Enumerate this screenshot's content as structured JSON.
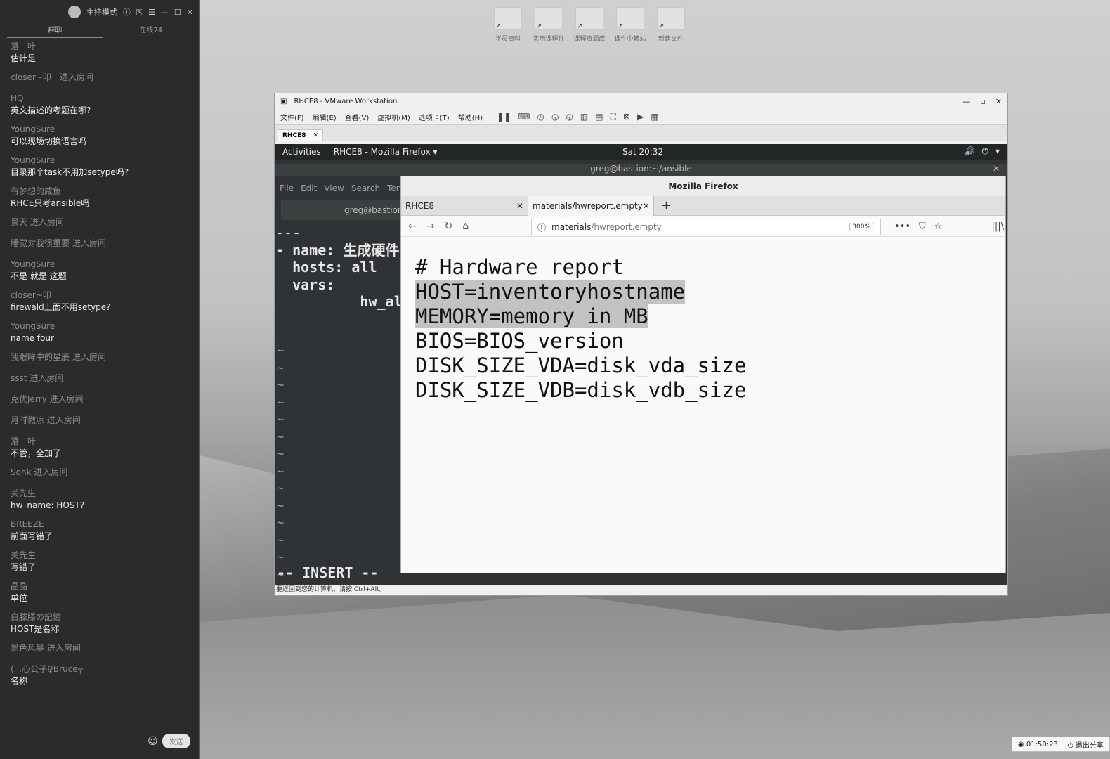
{
  "chat": {
    "mode_label": "主持模式",
    "tabs": [
      "群聊",
      "在线74"
    ],
    "messages": [
      {
        "name": "落　叶",
        "text": "估计是"
      },
      {
        "join": "closer~叩　进入房间"
      },
      {
        "name": "HQ",
        "text": "英文描述的考题在哪?"
      },
      {
        "name": "YoungSure",
        "text": "可以现场切换语言吗"
      },
      {
        "name": "YoungSure",
        "text": "目录那个task不用加setype吗?"
      },
      {
        "name": "有梦想的咸鱼",
        "text": "RHCE只考ansible吗"
      },
      {
        "join": "景天 进入房间"
      },
      {
        "join": "睡觉对我很重要 进入房间"
      },
      {
        "name": "YoungSure",
        "text": "不是  就是 这题"
      },
      {
        "name": "closer~叩",
        "text": "firewald上面不用setype?"
      },
      {
        "name": "YoungSure",
        "text": "name four"
      },
      {
        "join": "我眼眸中的星辰 进入房间"
      },
      {
        "join": "ssst 进入房间"
      },
      {
        "join": "克优Jerry 进入房间"
      },
      {
        "join": "月时微凉 进入房间"
      },
      {
        "name": "落　叶",
        "text": "不管，全加了"
      },
      {
        "join": "Sohk 进入房间"
      },
      {
        "name": "关先生",
        "text": "hw_name: HOST?"
      },
      {
        "name": "BREEZE",
        "text": "前面写错了"
      },
      {
        "name": "关先生",
        "text": "写错了"
      },
      {
        "name": "晶晶",
        "text": "单位"
      },
      {
        "name": "白滕滕の記憶",
        "text": "HOST是名称"
      },
      {
        "join": "黑色风暴 进入房间"
      },
      {
        "name": "(...心公子♀Bruce╤",
        "text": "名称"
      }
    ],
    "send_label": "发送"
  },
  "desktop": {
    "icons": [
      "学员资料",
      "实用课程件",
      "课程资源库",
      "课件中转站",
      "新建文件"
    ]
  },
  "vmware": {
    "title": "RHCE8 - VMware Workstation",
    "menu": [
      "文件(F)",
      "编辑(E)",
      "查看(V)",
      "虚拟机(M)",
      "选项卡(T)",
      "帮助(H)"
    ],
    "tab": "RHCE8",
    "status": "要返回到您的计算机，请按 Ctrl+Alt。"
  },
  "guest": {
    "activities": "Activities",
    "app": "RHCE8 - Mozilla Firefox ▾",
    "clock": "Sat 20:32",
    "terminal_title": "greg@bastion:~/ansible",
    "terminal_menu": [
      "File",
      "Edit",
      "View",
      "Search",
      "Ter"
    ],
    "terminal_tab": "greg@bastion:",
    "terminal_lines": [
      "---",
      "- name: 生成硬件",
      "  hosts: all",
      "  vars:",
      "          hw_al"
    ],
    "insert": "-- INSERT --"
  },
  "firefox": {
    "window_title": "Mozilla Firefox",
    "tabs": [
      "RHCE8",
      "materials/hwreport.empty"
    ],
    "url_host": "materials",
    "url_path": "/hwreport.empty",
    "zoom": "300%",
    "lines": [
      "# Hardware report",
      "HOST=inventoryhostname",
      "MEMORY=memory in MB",
      "BIOS=BIOS_version",
      "DISK_SIZE_VDA=disk_vda_size",
      "DISK_SIZE_VDB=disk_vdb_size"
    ]
  },
  "taskbar": {
    "timer": "01:50:23",
    "exit_share": "退出分享"
  }
}
